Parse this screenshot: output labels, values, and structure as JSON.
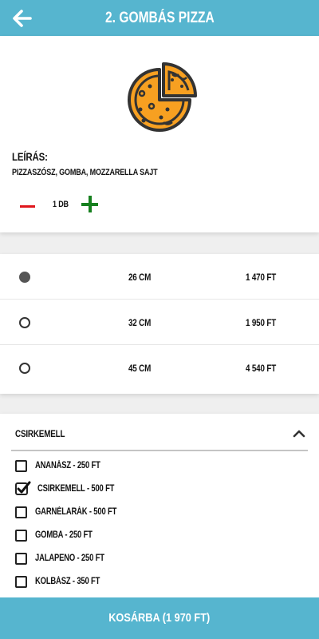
{
  "header": {
    "title": "2. GOMBÁS PIZZA"
  },
  "product": {
    "description_label": "LEÍRÁS:",
    "description": "PIZZASZÓSZ, GOMBA, MOZZARELLA SAJT",
    "quantity": "1 DB"
  },
  "sizes": [
    {
      "label": "26 CM",
      "price": "1 470 FT",
      "selected": true
    },
    {
      "label": "32 CM",
      "price": "1 950 FT",
      "selected": false
    },
    {
      "label": "45 CM",
      "price": "4 540 FT",
      "selected": false
    }
  ],
  "extras": {
    "title": "CSIRKEMELL",
    "items": [
      {
        "label": "ANANÁSZ - 250 FT",
        "checked": false
      },
      {
        "label": "CSIRKEMELL - 500 FT",
        "checked": true
      },
      {
        "label": "GARNÉLARÁK - 500 FT",
        "checked": false
      },
      {
        "label": "GOMBA - 250 FT",
        "checked": false
      },
      {
        "label": "JALAPENO - 250 FT",
        "checked": false
      },
      {
        "label": "KOLBÁSZ - 350 FT",
        "checked": false
      }
    ]
  },
  "cart": {
    "label": "KOSÁRBA (1 970 FT)"
  },
  "colors": {
    "accent": "#56b5cf",
    "minus": "#e0161c",
    "plus": "#17801f",
    "pizza": "#f7a021"
  },
  "icons": [
    "arrow-left-icon",
    "pizza-icon",
    "minus-icon",
    "plus-icon",
    "radio-icon",
    "chevron-up-icon",
    "checkbox-icon",
    "checkmark-icon"
  ]
}
